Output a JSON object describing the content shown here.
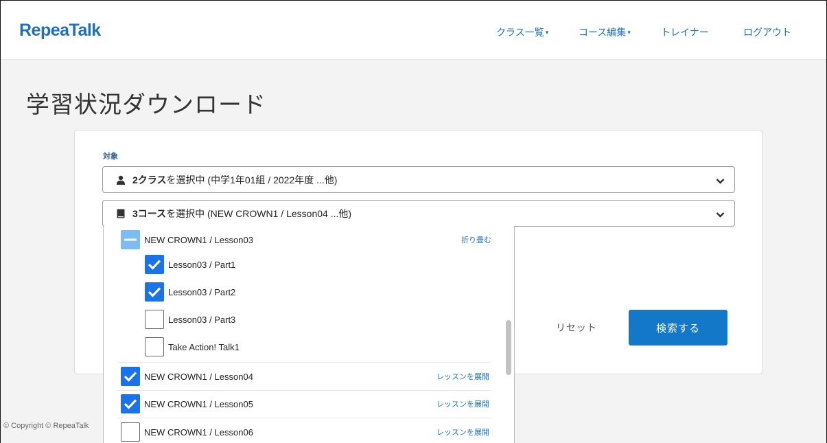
{
  "header": {
    "logo": "RepeaTalk",
    "nav": [
      {
        "label": "クラス一覧",
        "caret": "▾"
      },
      {
        "label": "コース編集",
        "caret": "▾"
      },
      {
        "label": "トレイナー",
        "caret": ""
      },
      {
        "label": "ログアウト",
        "caret": ""
      }
    ]
  },
  "page": {
    "title": "学習状況ダウンロード",
    "target_label": "対象"
  },
  "class_select": {
    "icon": "user-icon",
    "bold": "2クラス",
    "text": "を選択中 (中学1年01組 / 2022年度 ...他)"
  },
  "course_select": {
    "icon": "book-icon",
    "bold": "3コース",
    "text": "を選択中 (NEW CROWN1 / Lesson04 ...他)"
  },
  "dropdown": {
    "lesson03": {
      "label": "NEW CROWN1 / Lesson03",
      "action": "折り畳む",
      "state": "partial"
    },
    "parts": [
      {
        "label": "Lesson03 / Part1",
        "checked": true
      },
      {
        "label": "Lesson03 / Part2",
        "checked": true
      },
      {
        "label": "Lesson03 / Part3",
        "checked": false
      },
      {
        "label": "Take Action! Talk1",
        "checked": false
      }
    ],
    "lessons": [
      {
        "label": "NEW CROWN1 / Lesson04",
        "action": "レッスンを展開",
        "checked": true
      },
      {
        "label": "NEW CROWN1 / Lesson05",
        "action": "レッスンを展開",
        "checked": true
      },
      {
        "label": "NEW CROWN1 / Lesson06",
        "action": "レッスンを展開",
        "checked": false
      }
    ]
  },
  "buttons": {
    "reset": "リセット",
    "search": "検索する"
  },
  "footer": {
    "copyright": "© Copyright © RepeaTalk"
  },
  "colors": {
    "brand": "#1f6fbf",
    "primary_button": "#1478c8",
    "checkbox": "#1a73e8",
    "partial_checkbox": "#7bbcf2"
  }
}
